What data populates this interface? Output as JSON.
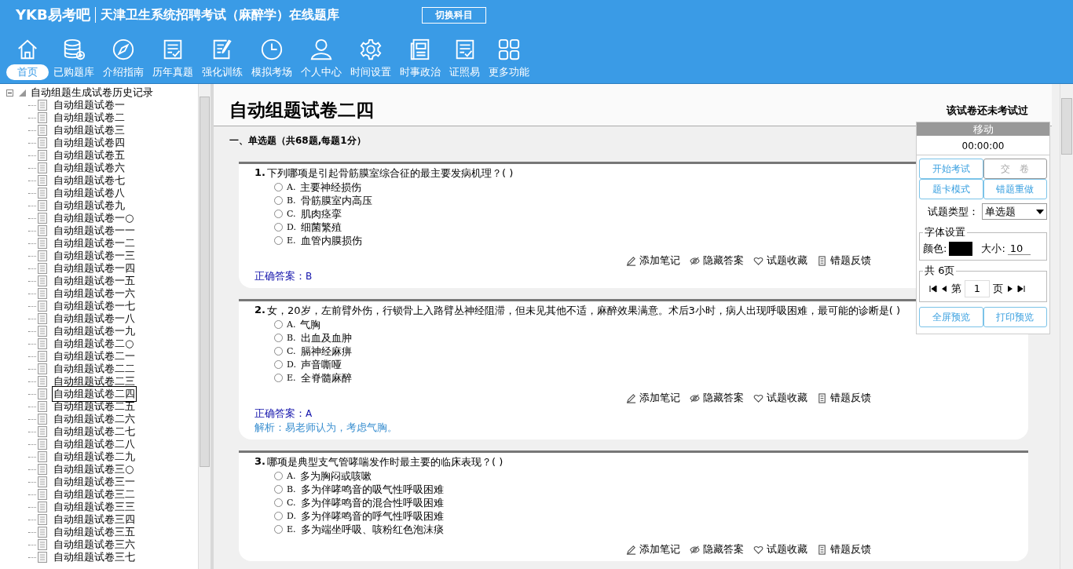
{
  "header": {
    "logo": "YKB易考吧",
    "title": "天津卫生系统招聘考试（麻醉学）在线题库",
    "switch_button": "切换科目"
  },
  "nav": [
    {
      "kind": "home",
      "label": "首页",
      "selected": true
    },
    {
      "kind": "database",
      "label": "已购题库",
      "selected": false
    },
    {
      "kind": "compass",
      "label": "介绍指南",
      "selected": false
    },
    {
      "kind": "list",
      "label": "历年真题",
      "selected": false
    },
    {
      "kind": "edit",
      "label": "强化训练",
      "selected": false
    },
    {
      "kind": "clock",
      "label": "模拟考场",
      "selected": false
    },
    {
      "kind": "person",
      "label": "个人中心",
      "selected": false
    },
    {
      "kind": "gear",
      "label": "时间设置",
      "selected": false
    },
    {
      "kind": "newspaper",
      "label": "时事政治",
      "selected": false
    },
    {
      "kind": "checklist",
      "label": "证照易",
      "selected": false
    },
    {
      "kind": "grid",
      "label": "更多功能",
      "selected": false
    }
  ],
  "tree": {
    "root": "自动组题生成试卷历史记录",
    "expanded": true,
    "items": [
      {
        "label": "自动组题试卷一",
        "selected": false
      },
      {
        "label": "自动组题试卷二",
        "selected": false
      },
      {
        "label": "自动组题试卷三",
        "selected": false
      },
      {
        "label": "自动组题试卷四",
        "selected": false
      },
      {
        "label": "自动组题试卷五",
        "selected": false
      },
      {
        "label": "自动组题试卷六",
        "selected": false
      },
      {
        "label": "自动组题试卷七",
        "selected": false
      },
      {
        "label": "自动组题试卷八",
        "selected": false
      },
      {
        "label": "自动组题试卷九",
        "selected": false
      },
      {
        "label": "自动组题试卷一○",
        "selected": false
      },
      {
        "label": "自动组题试卷一一",
        "selected": false
      },
      {
        "label": "自动组题试卷一二",
        "selected": false
      },
      {
        "label": "自动组题试卷一三",
        "selected": false
      },
      {
        "label": "自动组题试卷一四",
        "selected": false
      },
      {
        "label": "自动组题试卷一五",
        "selected": false
      },
      {
        "label": "自动组题试卷一六",
        "selected": false
      },
      {
        "label": "自动组题试卷一七",
        "selected": false
      },
      {
        "label": "自动组题试卷一八",
        "selected": false
      },
      {
        "label": "自动组题试卷一九",
        "selected": false
      },
      {
        "label": "自动组题试卷二○",
        "selected": false
      },
      {
        "label": "自动组题试卷二一",
        "selected": false
      },
      {
        "label": "自动组题试卷二二",
        "selected": false
      },
      {
        "label": "自动组题试卷二三",
        "selected": false
      },
      {
        "label": "自动组题试卷二四",
        "selected": true
      },
      {
        "label": "自动组题试卷二五",
        "selected": false
      },
      {
        "label": "自动组题试卷二六",
        "selected": false
      },
      {
        "label": "自动组题试卷二七",
        "selected": false
      },
      {
        "label": "自动组题试卷二八",
        "selected": false
      },
      {
        "label": "自动组题试卷二九",
        "selected": false
      },
      {
        "label": "自动组题试卷三○",
        "selected": false
      },
      {
        "label": "自动组题试卷三一",
        "selected": false
      },
      {
        "label": "自动组题试卷三二",
        "selected": false
      },
      {
        "label": "自动组题试卷三三",
        "selected": false
      },
      {
        "label": "自动组题试卷三四",
        "selected": false
      },
      {
        "label": "自动组题试卷三五",
        "selected": false
      },
      {
        "label": "自动组题试卷三六",
        "selected": false
      },
      {
        "label": "自动组题试卷三七",
        "selected": false
      }
    ]
  },
  "paper": {
    "title": "自动组题试卷二四",
    "status": "该试卷还未考试过",
    "section": "一、单选题（共68题,每题1分）",
    "questions": [
      {
        "number": "1.",
        "text": "下列哪项是引起骨筋膜室综合征的最主要发病机理？( )",
        "options": [
          {
            "letter": "A.",
            "text": "主要神经损伤",
            "selected": false
          },
          {
            "letter": "B.",
            "text": "骨筋膜室内高压",
            "selected": false
          },
          {
            "letter": "C.",
            "text": "肌肉痉挛",
            "selected": false
          },
          {
            "letter": "D.",
            "text": "细菌繁殖",
            "selected": false
          },
          {
            "letter": "E.",
            "text": "血管内膜损伤",
            "selected": false
          }
        ],
        "actions": [
          "添加笔记",
          "隐藏答案",
          "试题收藏",
          "错题反馈"
        ],
        "answer_label": "正确答案：",
        "answer": "B"
      },
      {
        "number": "2.",
        "text": "女，20岁，左前臂外伤，行锁骨上入路臂丛神经阻滞，但未见其他不适，麻醉效果满意。术后3小时，病人出现呼吸困难，最可能的诊断是( )",
        "options": [
          {
            "letter": "A.",
            "text": "气胸",
            "selected": false
          },
          {
            "letter": "B.",
            "text": "出血及血肿",
            "selected": false
          },
          {
            "letter": "C.",
            "text": "膈神经麻痹",
            "selected": false
          },
          {
            "letter": "D.",
            "text": "声音嘶哑",
            "selected": false
          },
          {
            "letter": "E.",
            "text": "全脊髓麻醉",
            "selected": false
          }
        ],
        "actions": [
          "添加笔记",
          "隐藏答案",
          "试题收藏",
          "错题反馈"
        ],
        "answer_label": "正确答案：",
        "answer": "A",
        "explanation": "解析：易老师认为，考虑气胸。"
      },
      {
        "number": "3.",
        "text": "哪项是典型支气管哮喘发作时最主要的临床表现？( )",
        "options": [
          {
            "letter": "A.",
            "text": "多为胸闷或咳嗽",
            "selected": false
          },
          {
            "letter": "B.",
            "text": "多为伴哮鸣音的吸气性呼吸困难",
            "selected": false
          },
          {
            "letter": "C.",
            "text": "多为伴哮鸣音的混合性呼吸困难",
            "selected": false
          },
          {
            "letter": "D.",
            "text": "多为伴哮鸣音的呼气性呼吸困难",
            "selected": false
          },
          {
            "letter": "E.",
            "text": "多为端坐呼吸、咳粉红色泡沫痰",
            "selected": false
          }
        ],
        "actions": [
          "添加笔记",
          "隐藏答案",
          "试题收藏",
          "错题反馈"
        ]
      }
    ]
  },
  "panel": {
    "header": "移动",
    "timer": "00:00:00",
    "buttons": [
      {
        "label": "开始考试",
        "disabled": false
      },
      {
        "label": "交　卷",
        "disabled": true
      },
      {
        "label": "题卡模式",
        "disabled": false
      },
      {
        "label": "错题重做",
        "disabled": false
      }
    ],
    "type_label": "试题类型：",
    "type_value": "单选题",
    "font_legend": "字体设置",
    "color_label": "颜色:",
    "color": "#000000",
    "size_label": "大小:",
    "size": "10",
    "pages_legend": "共 6页",
    "page_prefix": "第",
    "page": "1",
    "page_suffix": "页",
    "preview_buttons": [
      "全屏预览",
      "打印预览"
    ]
  }
}
